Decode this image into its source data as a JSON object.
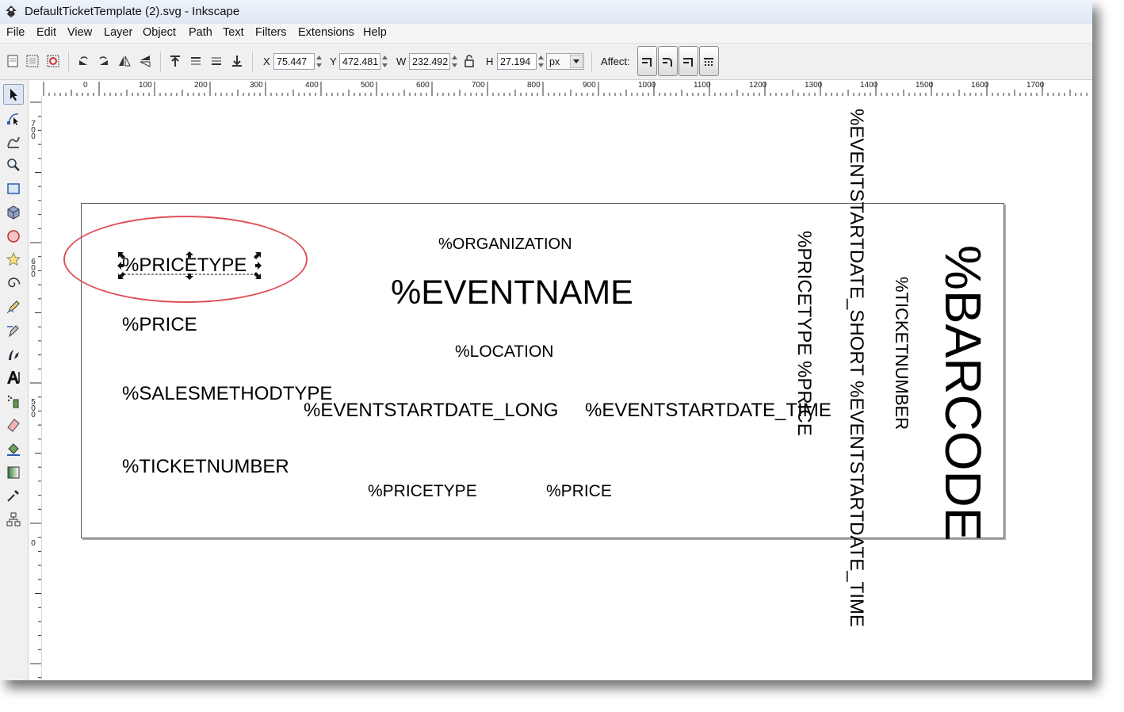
{
  "window": {
    "title": "DefaultTicketTemplate (2).svg - Inkscape",
    "app_icon": "inkscape-logo-icon"
  },
  "menu": [
    "File",
    "Edit",
    "View",
    "Layer",
    "Object",
    "Path",
    "Text",
    "Filters",
    "Extensions",
    "Help"
  ],
  "toolbar": {
    "x_label": "X",
    "x_value": "75.447",
    "y_label": "Y",
    "y_value": "472.481",
    "w_label": "W",
    "w_value": "232.492",
    "h_label": "H",
    "h_value": "27.194",
    "unit": "px",
    "affect_label": "Affect:"
  },
  "ruler": {
    "h_labels": [
      "0",
      "100",
      "200",
      "300",
      "400",
      "500",
      "600",
      "700",
      "800",
      "900",
      "1000",
      "1100",
      "1200",
      "1300",
      "1400",
      "1500",
      "1600",
      "1700"
    ],
    "v_labels": [
      "700",
      "600",
      "500",
      "0"
    ]
  },
  "canvas": {
    "texts": {
      "organization": "%ORGANIZATION",
      "eventname": "%EVENTNAME",
      "pricetype_selected": "%PRICETYPE",
      "price": "%PRICE",
      "location": "%LOCATION",
      "salesmethodtype": "%SALESMETHODTYPE",
      "startdate_long": "%EVENTSTARTDATE_LONG",
      "startdate_time": "%EVENTSTARTDATE_TIME",
      "ticketnumber": "%TICKETNUMBER",
      "pricetype_small": "%PRICETYPE",
      "price_small": "%PRICE",
      "v_pricetype_price": "%PRICETYPE  %PRICE",
      "v_startdate_short_time": "%EVENTSTARTDATE_SHORT  %EVENTSTARTDATE_TIME",
      "v_ticketnumber": "%TICKETNUMBER",
      "v_barcode": "%BARCODE"
    },
    "highlight_color": "#e0505a"
  }
}
